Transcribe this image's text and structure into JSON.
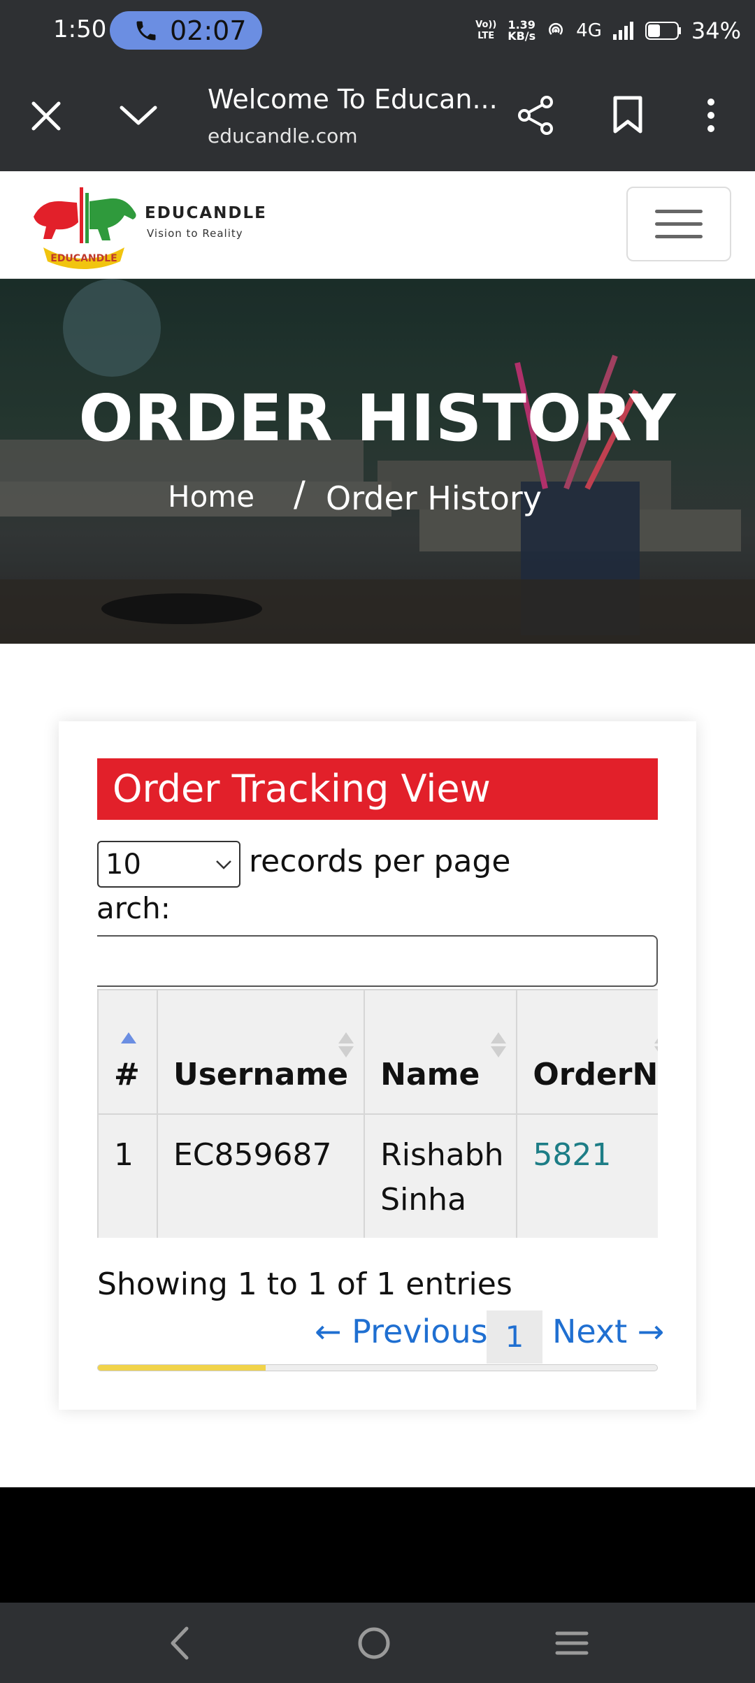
{
  "status_bar": {
    "time": "1:50",
    "call_timer": "02:07",
    "volte": "Vo)) LTE",
    "speed_value": "1.39",
    "speed_unit": "KB/s",
    "network": "4G",
    "battery": "34%"
  },
  "browser": {
    "page_title": "Welcome To Educan...",
    "url": "educandle.com"
  },
  "site": {
    "brand": "EDUCANDLE",
    "tagline": "Vision to Reality",
    "logo_ribbon": "EDUCANDLE",
    "menu_icon": "hamburger-icon"
  },
  "hero": {
    "title": "ORDER HISTORY",
    "breadcrumb_home": "Home",
    "breadcrumb_sep": "/",
    "breadcrumb_current": "Order History"
  },
  "card": {
    "heading": "Order Tracking View",
    "records_value": "10",
    "records_label": "records per page",
    "search_label": "arch:",
    "search_value": "",
    "table": {
      "headers": [
        "#",
        "Username",
        "Name",
        "OrderNo"
      ],
      "rows": [
        {
          "num": "1",
          "username": "EC859687",
          "name": "Rishabh Sinha",
          "orderno": "5821"
        }
      ]
    },
    "info": "Showing 1 to 1 of 1 entries",
    "prev": "← Previous",
    "page": "1",
    "next": "Next →",
    "horizontal_scroll_fraction": 0.3
  },
  "colors": {
    "header_red": "#e2202a",
    "link_blue": "#1f6fd1",
    "order_link": "#1d7d86",
    "scroll_yellow": "#f1d34a"
  }
}
